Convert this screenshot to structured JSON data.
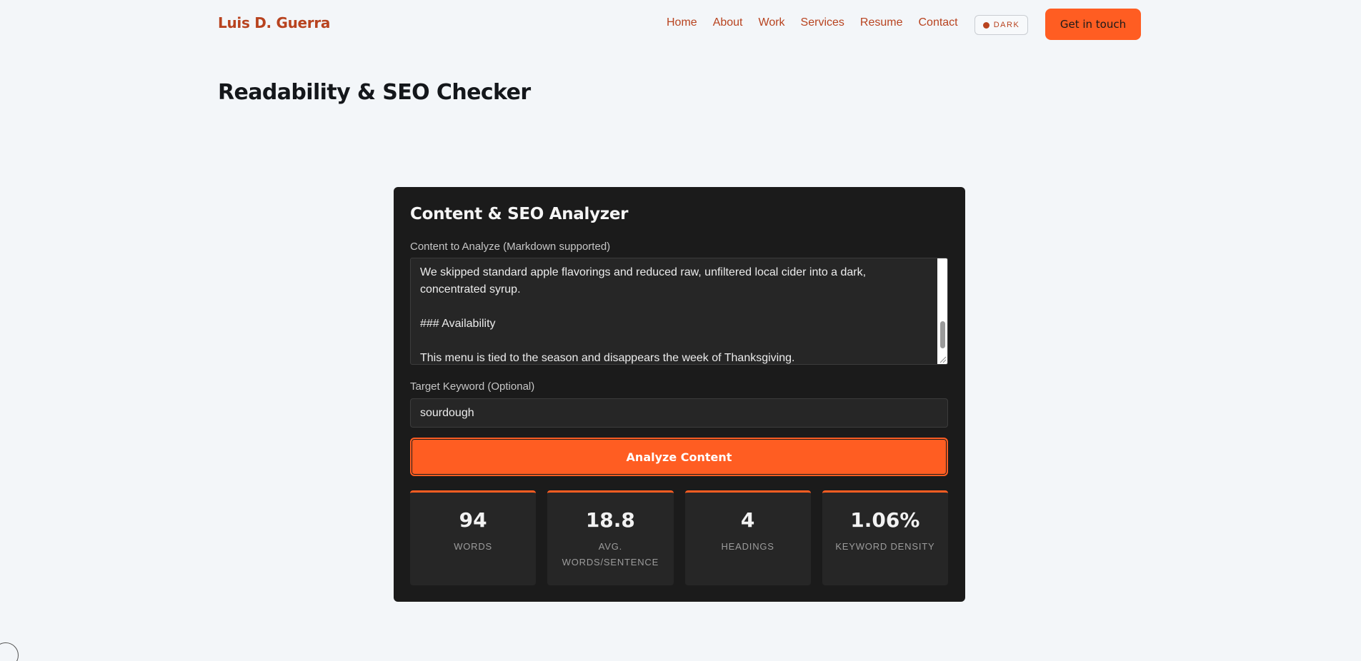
{
  "header": {
    "brand": "Luis D. Guerra",
    "nav": [
      "Home",
      "About",
      "Work",
      "Services",
      "Resume",
      "Contact"
    ],
    "theme_toggle": "DARK",
    "cta": "Get in touch"
  },
  "page": {
    "title": "Readability & SEO Checker"
  },
  "analyzer": {
    "title": "Content & SEO Analyzer",
    "content_label": "Content to Analyze (Markdown supported)",
    "content_lines": [
      "We skipped standard apple flavorings and reduced raw, unfiltered local cider into a dark, concentrated syrup.",
      "### Availability",
      "This menu is tied to the season and disappears the week of Thanksgiving."
    ],
    "keyword_label": "Target Keyword (Optional)",
    "keyword_value": "sourdough",
    "analyze_button": "Analyze Content",
    "stats": [
      {
        "value": "94",
        "label": "Words"
      },
      {
        "value": "18.8",
        "label": "Avg. Words/Sentence"
      },
      {
        "value": "4",
        "label": "Headings"
      },
      {
        "value": "1.06%",
        "label": "Keyword Density"
      }
    ]
  },
  "colors": {
    "accent": "#ff5d22",
    "brand_text": "#b8431f",
    "card_bg": "#1b1b1b",
    "page_bg": "#f3f6f9"
  }
}
